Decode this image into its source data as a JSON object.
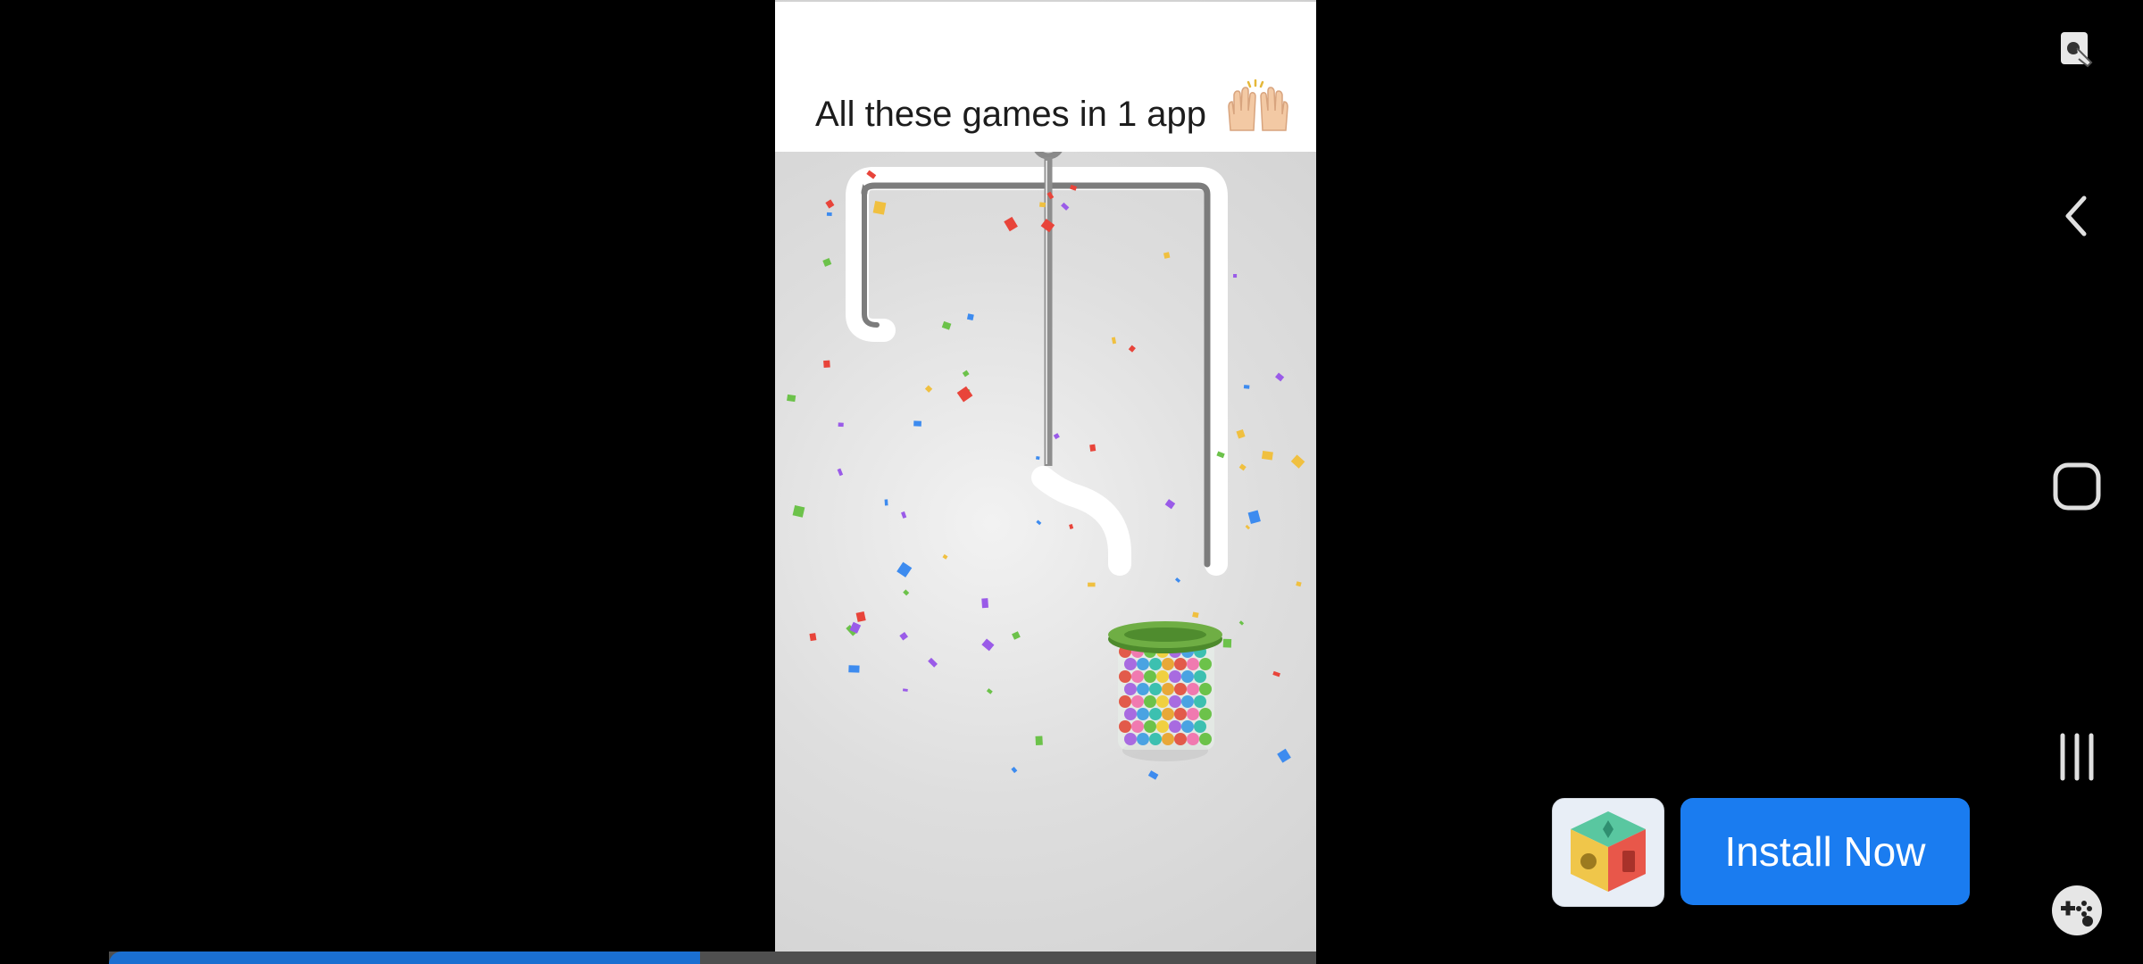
{
  "ad": {
    "banner_text": "All these games in 1 app",
    "banner_emoji_icon": "raising-hands-icon",
    "install_label": "Install Now",
    "app_icon": "cube-puzzle-app-icon",
    "accent_color": "#1a7cf0"
  },
  "game": {
    "scene": "pin-pull-ball-jar",
    "jar_color": "#5f9f3a",
    "background_color": "#dcdcdc"
  },
  "video": {
    "progress": 0.49,
    "progress_color": "#1a6fd1"
  },
  "nav": {
    "icons": [
      "screen-pin-icon",
      "back-icon",
      "home-icon",
      "recents-icon",
      "game-launcher-icon"
    ]
  }
}
